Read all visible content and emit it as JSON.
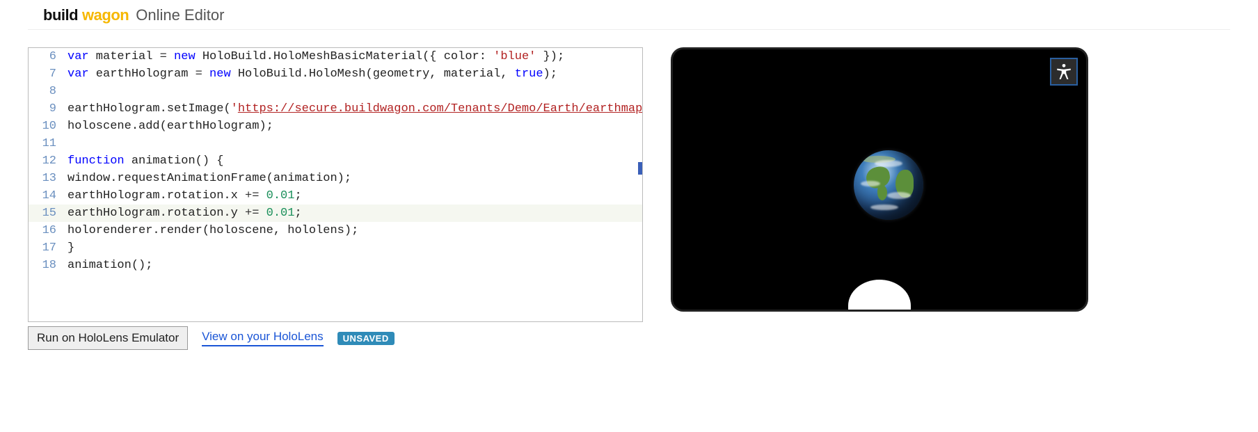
{
  "header": {
    "logo_prefix": "build",
    "logo_accent": "wagon",
    "title_suffix": "Online Editor"
  },
  "editor": {
    "first_line_number": 6,
    "highlighted_line": 15,
    "lines": [
      [
        {
          "t": "kw",
          "v": "var"
        },
        {
          "t": "plain",
          "v": " material "
        },
        {
          "t": "op",
          "v": "="
        },
        {
          "t": "plain",
          "v": " "
        },
        {
          "t": "kw",
          "v": "new"
        },
        {
          "t": "plain",
          "v": " HoloBuild.HoloMeshBasicMaterial({ color: "
        },
        {
          "t": "str",
          "v": "'blue'"
        },
        {
          "t": "plain",
          "v": " });"
        }
      ],
      [
        {
          "t": "kw",
          "v": "var"
        },
        {
          "t": "plain",
          "v": " earthHologram "
        },
        {
          "t": "op",
          "v": "="
        },
        {
          "t": "plain",
          "v": " "
        },
        {
          "t": "kw",
          "v": "new"
        },
        {
          "t": "plain",
          "v": " HoloBuild.HoloMesh(geometry, material, "
        },
        {
          "t": "bool",
          "v": "true"
        },
        {
          "t": "plain",
          "v": ");"
        }
      ],
      [],
      [
        {
          "t": "plain",
          "v": "earthHologram.setImage("
        },
        {
          "t": "str",
          "v": "'"
        },
        {
          "t": "url",
          "v": "https://secure.buildwagon.com/Tenants/Demo/Earth/earthmap"
        }
      ],
      [
        {
          "t": "plain",
          "v": "holoscene.add(earthHologram);"
        }
      ],
      [],
      [
        {
          "t": "kw",
          "v": "function"
        },
        {
          "t": "plain",
          "v": " animation() {"
        }
      ],
      [
        {
          "t": "plain",
          "v": "window.requestAnimationFrame(animation);"
        }
      ],
      [
        {
          "t": "plain",
          "v": "earthHologram.rotation.x "
        },
        {
          "t": "op",
          "v": "+="
        },
        {
          "t": "plain",
          "v": " "
        },
        {
          "t": "num",
          "v": "0.01"
        },
        {
          "t": "plain",
          "v": ";"
        }
      ],
      [
        {
          "t": "plain",
          "v": "earthHologram.rotation.y "
        },
        {
          "t": "op",
          "v": "+="
        },
        {
          "t": "plain",
          "v": " "
        },
        {
          "t": "num",
          "v": "0.01"
        },
        {
          "t": "plain",
          "v": ";"
        }
      ],
      [
        {
          "t": "plain",
          "v": "holorenderer.render(holoscene, hololens);"
        }
      ],
      [
        {
          "t": "plain",
          "v": "}"
        }
      ],
      [
        {
          "t": "plain",
          "v": "animation();"
        }
      ]
    ]
  },
  "toolbar": {
    "run_label": "Run on HoloLens Emulator",
    "view_label": "View on your HoloLens",
    "save_badge": "UNSAVED"
  },
  "preview": {
    "object_name": "earth-hologram",
    "corner_icon_name": "accessibility-icon"
  }
}
